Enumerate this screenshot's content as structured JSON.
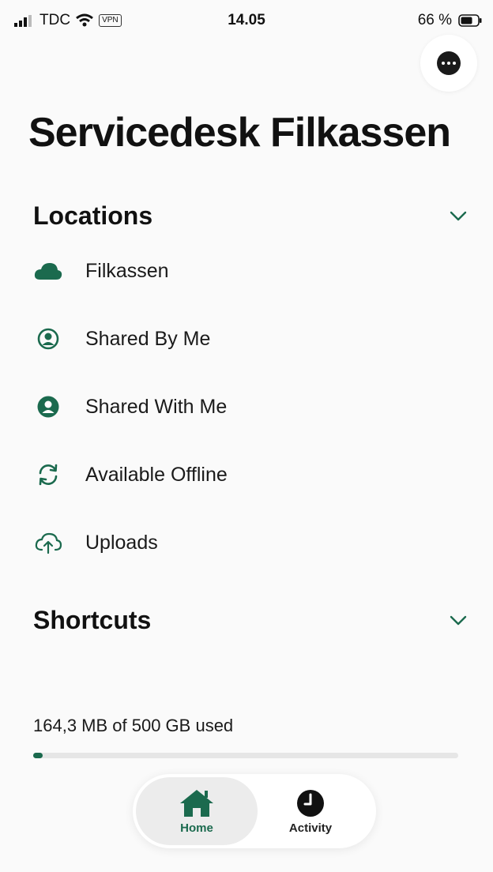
{
  "status_bar": {
    "carrier": "TDC",
    "vpn_label": "VPN",
    "time": "14.05",
    "battery": "66 %"
  },
  "header": {
    "more_icon": "ellipsis-circle-icon",
    "title": "Servicedesk Filkassen"
  },
  "locations": {
    "title": "Locations",
    "items": [
      {
        "label": "Filkassen",
        "icon": "cloud-icon"
      },
      {
        "label": "Shared By Me",
        "icon": "user-outline-icon"
      },
      {
        "label": "Shared With Me",
        "icon": "user-filled-icon"
      },
      {
        "label": "Available Offline",
        "icon": "sync-icon"
      },
      {
        "label": "Uploads",
        "icon": "cloud-upload-icon"
      }
    ]
  },
  "shortcuts": {
    "title": "Shortcuts"
  },
  "storage": {
    "text": "164,3 MB of 500 GB used",
    "used_fraction": 0.0003
  },
  "tabs": [
    {
      "label": "Home",
      "icon": "home-icon",
      "active": true
    },
    {
      "label": "Activity",
      "icon": "clock-icon",
      "active": false
    }
  ],
  "colors": {
    "accent": "#1b6a4e",
    "background": "#fafafa"
  }
}
